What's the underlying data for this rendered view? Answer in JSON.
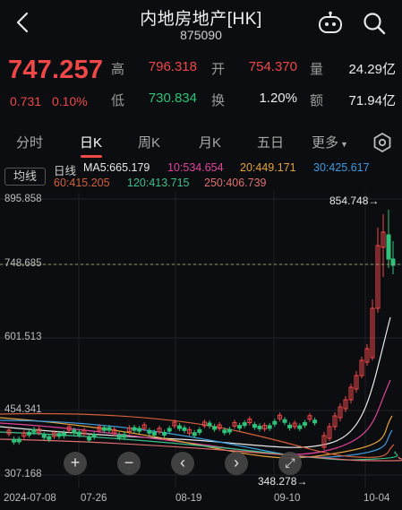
{
  "header": {
    "title": "内地房地产[HK]",
    "code": "875090"
  },
  "quote": {
    "price": "747.257",
    "change": "0.731",
    "change_pct": "0.10%",
    "high_label": "高",
    "high": "796.318",
    "open_label": "开",
    "open": "754.370",
    "volume_label": "量",
    "volume": "24.29亿",
    "low_label": "低",
    "low": "730.834",
    "turnover_label": "换",
    "turnover": "1.20%",
    "amount_label": "额",
    "amount": "71.94亿"
  },
  "tabs": [
    "分时",
    "日K",
    "周K",
    "月K",
    "五日",
    "更多"
  ],
  "active_tab": "日K",
  "ma": {
    "button": "均线",
    "line_label": "日线",
    "ma5": "MA5:665.179",
    "ma10": "10:534.654",
    "ma20": "20:449.171",
    "ma30": "30:425.617",
    "ma60": "60:415.205",
    "ma120": "120:413.715",
    "ma250": "250:406.739"
  },
  "colors": {
    "up": "#f04848",
    "down": "#2fc27a",
    "ma5": "#e8e8e8",
    "ma10": "#e0449a",
    "ma20": "#e6a23c",
    "ma30": "#3d9ce0",
    "ma60": "#d4603a",
    "ma120": "#3cc08a",
    "ma250": "#e07070"
  },
  "chart": {
    "y_labels": [
      "895.858",
      "748.685",
      "601.513",
      "454.341",
      "307.168"
    ],
    "x_labels": [
      "2024-07-08",
      "07-26",
      "08-19",
      "09-10",
      "10-04"
    ],
    "max_annotation": "854.748→",
    "min_annotation": "348.278→",
    "current_price_line": "748.685",
    "controls": [
      "+",
      "−",
      "‹",
      "›",
      "⤢"
    ]
  }
}
